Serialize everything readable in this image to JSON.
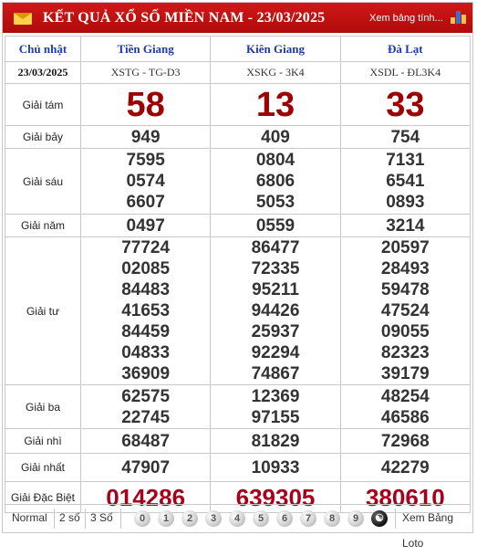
{
  "header": {
    "title": "KẾT QUẢ XỔ SỐ MIỀN NAM - 23/03/2025",
    "more_link": "Xem bảng tính...",
    "icons": {
      "mail": "envelope-icon",
      "chart": "bar-chart-icon"
    },
    "colors": {
      "title_bar": "#c41212",
      "label_blue": "#1c3d9e",
      "prize_red": "#9c0000"
    }
  },
  "table": {
    "day": "Chủ nhật",
    "date": "23/03/2025",
    "provinces": [
      {
        "name": "Tiền Giang",
        "code": "XSTG - TG-D3"
      },
      {
        "name": "Kiên Giang",
        "code": "XSKG - 3K4"
      },
      {
        "name": "Đà Lạt",
        "code": "XSDL - ĐL3K4"
      }
    ],
    "prizes": {
      "g8": {
        "label": "Giải tám",
        "values": [
          "58",
          "13",
          "33"
        ]
      },
      "g7": {
        "label": "Giải bảy",
        "values": [
          "949",
          "409",
          "754"
        ]
      },
      "g6": {
        "label": "Giải sáu",
        "values": [
          [
            "7595",
            "0574",
            "6607"
          ],
          [
            "0804",
            "6806",
            "5053"
          ],
          [
            "7131",
            "6541",
            "0893"
          ]
        ]
      },
      "g5": {
        "label": "Giải năm",
        "values": [
          "0497",
          "0559",
          "3214"
        ]
      },
      "g4": {
        "label": "Giải tư",
        "values": [
          [
            "77724",
            "02085",
            "84483",
            "41653",
            "84459",
            "04833",
            "36909"
          ],
          [
            "86477",
            "72335",
            "95211",
            "94426",
            "25937",
            "92294",
            "74867"
          ],
          [
            "20597",
            "28493",
            "59478",
            "47524",
            "09055",
            "82323",
            "39179"
          ]
        ]
      },
      "g3": {
        "label": "Giải ba",
        "values": [
          [
            "62575",
            "22745"
          ],
          [
            "12369",
            "97155"
          ],
          [
            "48254",
            "46586"
          ]
        ]
      },
      "g2": {
        "label": "Giải nhì",
        "values": [
          "68487",
          "81829",
          "72968"
        ]
      },
      "g1": {
        "label": "Giải nhất",
        "values": [
          "47907",
          "10933",
          "42279"
        ]
      },
      "db": {
        "label": "Giải Đặc Biệt",
        "values": [
          "014286",
          "639305",
          "380610"
        ]
      }
    }
  },
  "footer": {
    "modes": [
      "Normal",
      "2 số",
      "3 Số"
    ],
    "digits": [
      "0",
      "1",
      "2",
      "3",
      "4",
      "5",
      "6",
      "7",
      "8",
      "9"
    ],
    "last_ball_icon": "yin-yang-icon",
    "view_link": "Xem Bảng Loto"
  }
}
